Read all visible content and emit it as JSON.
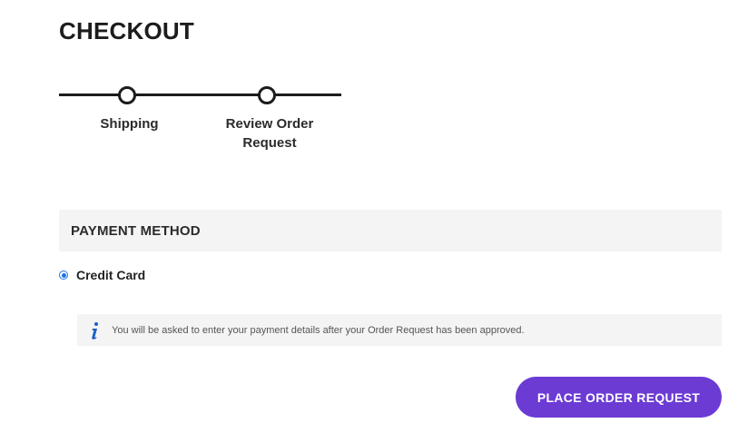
{
  "page": {
    "title": "CHECKOUT"
  },
  "steps": [
    {
      "label": "Shipping"
    },
    {
      "label": "Review Order\nRequest"
    }
  ],
  "payment": {
    "header": "PAYMENT METHOD",
    "method_label": "Credit Card",
    "selected": true
  },
  "info": {
    "icon": "info-icon",
    "text": "You will be asked to enter your payment details after your Order Request has been approved."
  },
  "actions": {
    "place_order_label": "PLACE ORDER REQUEST"
  },
  "colors": {
    "accent": "#6c3bd4",
    "radio": "#1a73e8",
    "panel_bg": "#f4f4f4",
    "text_dark": "#1c1c1c"
  }
}
